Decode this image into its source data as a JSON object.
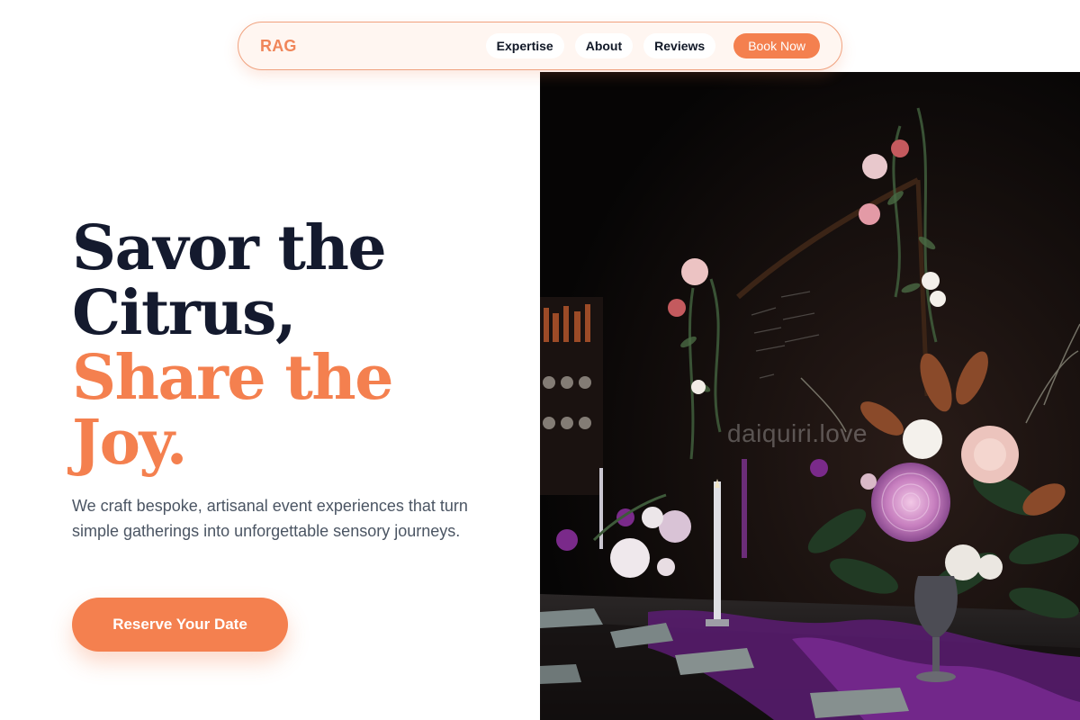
{
  "nav": {
    "brand": "RAG",
    "links": [
      "Expertise",
      "About",
      "Reviews"
    ],
    "cta": "Book Now"
  },
  "hero": {
    "title_lines": [
      "Savor the",
      "Citrus,"
    ],
    "accent_lines": [
      "Share the",
      "Joy."
    ],
    "description": "We craft bespoke, artisanal event experiences that turn simple gatherings into unforgettable sensory journeys.",
    "cta": "Reserve Your Date"
  },
  "image": {
    "watermark": "daiquiri.love"
  },
  "colors": {
    "accent": "#f4804f",
    "heading": "#141a2e",
    "body_text": "#4b5563",
    "nav_border": "#f0a27f"
  }
}
